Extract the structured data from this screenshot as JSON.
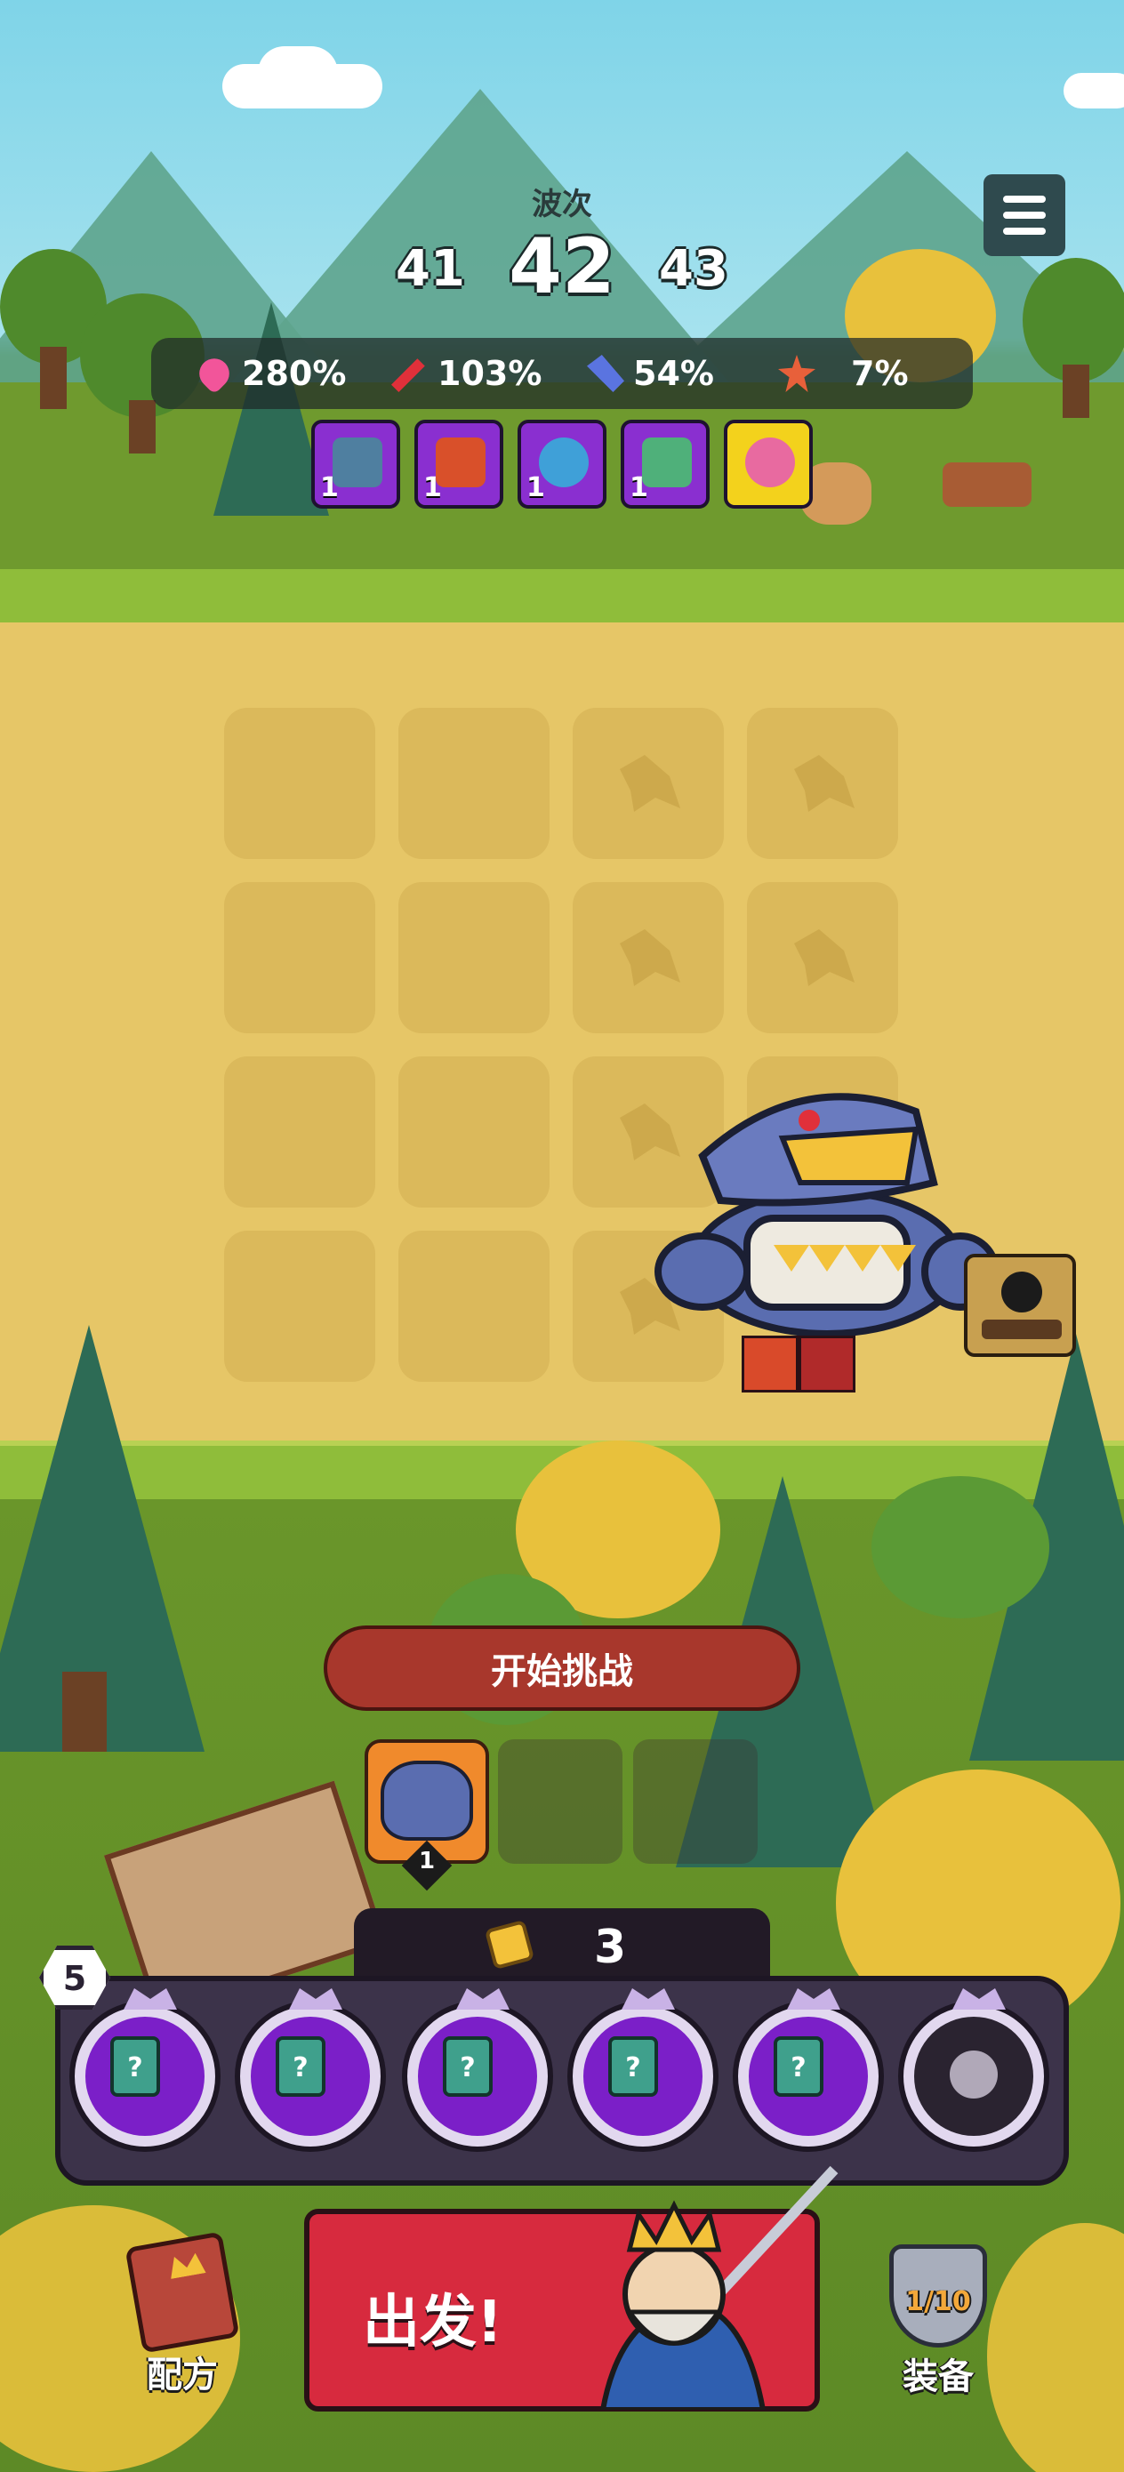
{
  "wave": {
    "label": "波次",
    "prev": "41",
    "current": "42",
    "next": "43"
  },
  "stats": [
    {
      "icon": "heart-icon",
      "value": "280%",
      "color": "#f2559a"
    },
    {
      "icon": "sword-icon",
      "value": "103%",
      "color": "#e0303a"
    },
    {
      "icon": "blue-sword-icon",
      "value": "54%",
      "color": "#5a74e0"
    },
    {
      "icon": "burst-icon",
      "value": "7%",
      "color": "#e8603a"
    }
  ],
  "buffs": [
    {
      "icon": "shark-beast-icon",
      "level": "1",
      "color": "#8a2fd0"
    },
    {
      "icon": "fire-armor-icon",
      "level": "1",
      "color": "#8a2fd0"
    },
    {
      "icon": "timer-icon",
      "level": "1",
      "color": "#8a2fd0"
    },
    {
      "icon": "grid-sword-icon",
      "level": "1",
      "color": "#8a2fd0"
    },
    {
      "icon": "flower-icon",
      "level": "",
      "color": "#f3d21c"
    }
  ],
  "start_button": "开始挑战",
  "team": {
    "unit_level": "1"
  },
  "coins": "3",
  "player_level": "5",
  "cards": [
    {
      "icon": "mystery-card-icon",
      "q": "?"
    },
    {
      "icon": "mystery-card-icon",
      "q": "?"
    },
    {
      "icon": "mystery-card-icon",
      "q": "?"
    },
    {
      "icon": "mystery-card-icon",
      "q": "?"
    },
    {
      "icon": "mystery-card-icon",
      "q": "?"
    },
    {
      "icon": "locked-avatar-icon",
      "q": ""
    }
  ],
  "go_button": "出发!",
  "recipes_label": "配方",
  "equipment": {
    "label": "装备",
    "count": "1/10"
  }
}
